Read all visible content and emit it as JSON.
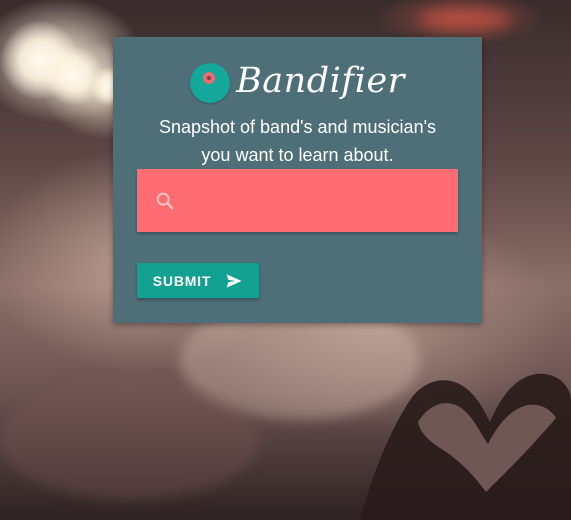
{
  "app": {
    "brand_name": "Bandifier",
    "logo_icon": "vinyl-record-icon",
    "tagline_line1": "Snapshot of band's and musician's",
    "tagline_line2": "you want to learn about."
  },
  "search": {
    "value": "",
    "placeholder": "",
    "icon": "search-icon"
  },
  "submit": {
    "label": "SUBMIT",
    "icon": "send-icon"
  },
  "colors": {
    "card": "#4e6e78",
    "search_field": "#ff6d72",
    "accent": "#12a091"
  }
}
